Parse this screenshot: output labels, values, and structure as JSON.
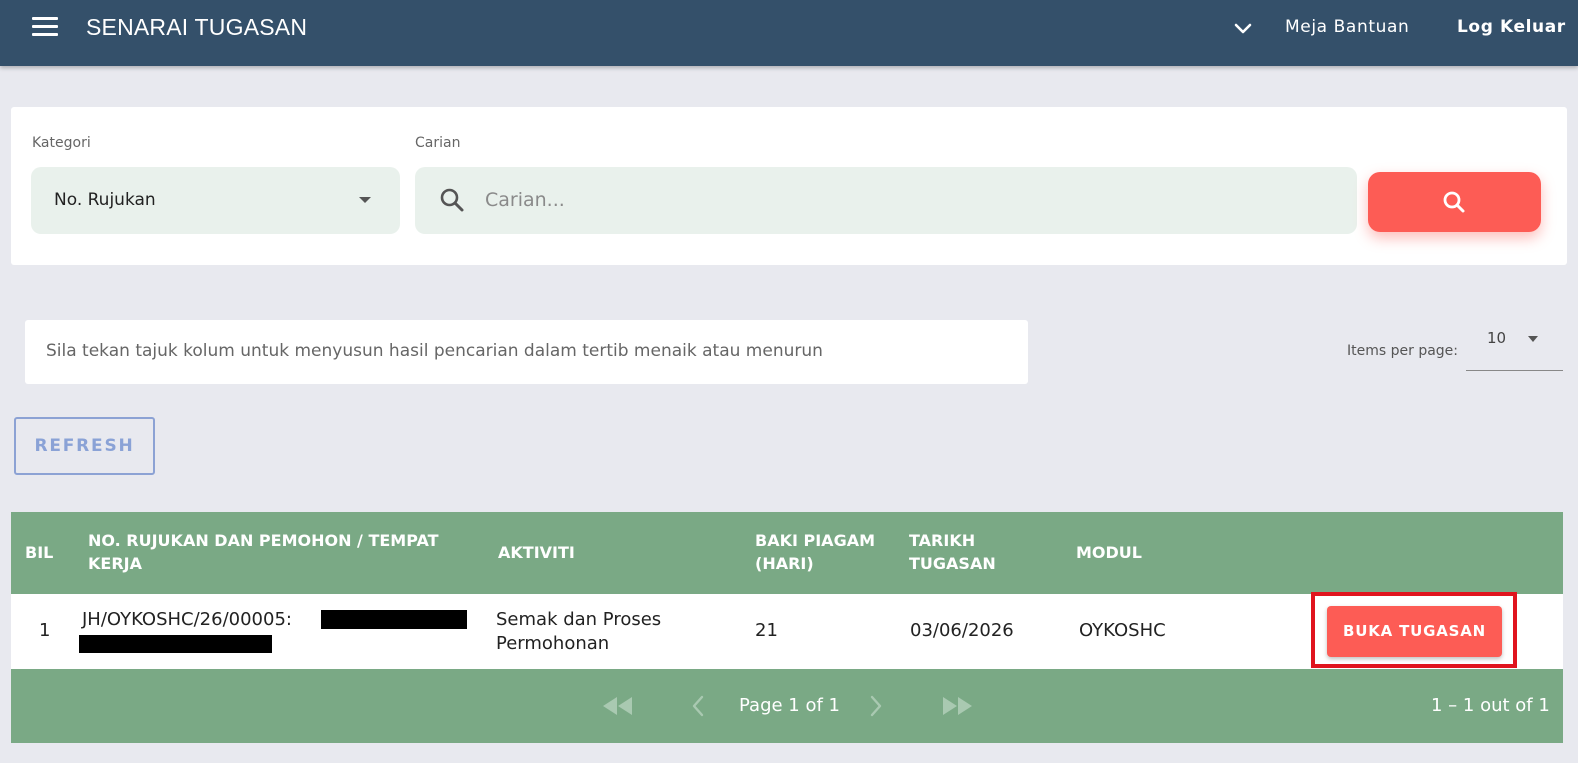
{
  "header": {
    "title": "SENARAI TUGASAN",
    "help_label": "Meja Bantuan",
    "logout_label": "Log Keluar"
  },
  "search": {
    "category_label": "Kategori",
    "category_value": "No. Rujukan",
    "query_label": "Carian",
    "query_placeholder": "Carian...",
    "query_value": ""
  },
  "hint": "Sila tekan tajuk kolum untuk menyusun hasil pencarian dalam tertib menaik atau menurun",
  "paging": {
    "items_per_page_label": "Items per page:",
    "items_per_page_value": "10",
    "page_text": "Page 1 of 1",
    "range_text": "1 – 1 out of 1"
  },
  "refresh_label": "REFRESH",
  "table": {
    "columns": [
      "BIL",
      "NO. RUJUKAN DAN PEMOHON / TEMPAT KERJA",
      "AKTIVITI",
      "BAKI PIAGAM (HARI)",
      "TARIKH TUGASAN",
      "MODUL"
    ],
    "rows": [
      {
        "bil": "1",
        "rujukan": "JH/OYKOSHC/26/00005:",
        "aktiviti": "Semak dan Proses Permohonan",
        "baki": "21",
        "tarikh": "03/06/2026",
        "modul": "OYKOSHC",
        "action_label": "BUKA TUGASAN"
      }
    ]
  },
  "colors": {
    "topbar": "#34506a",
    "accent_red": "#fd5c55",
    "table_green": "#7aa985",
    "input_bg": "#e9f1ec",
    "highlight_border": "#e0141e"
  },
  "icons": {
    "menu": "hamburger-menu-icon",
    "dropdown": "chevron-down-icon",
    "search": "magnifier-icon",
    "first": "double-arrow-left-icon",
    "prev": "chevron-left-icon",
    "next": "chevron-right-icon",
    "last": "double-arrow-right-icon"
  }
}
